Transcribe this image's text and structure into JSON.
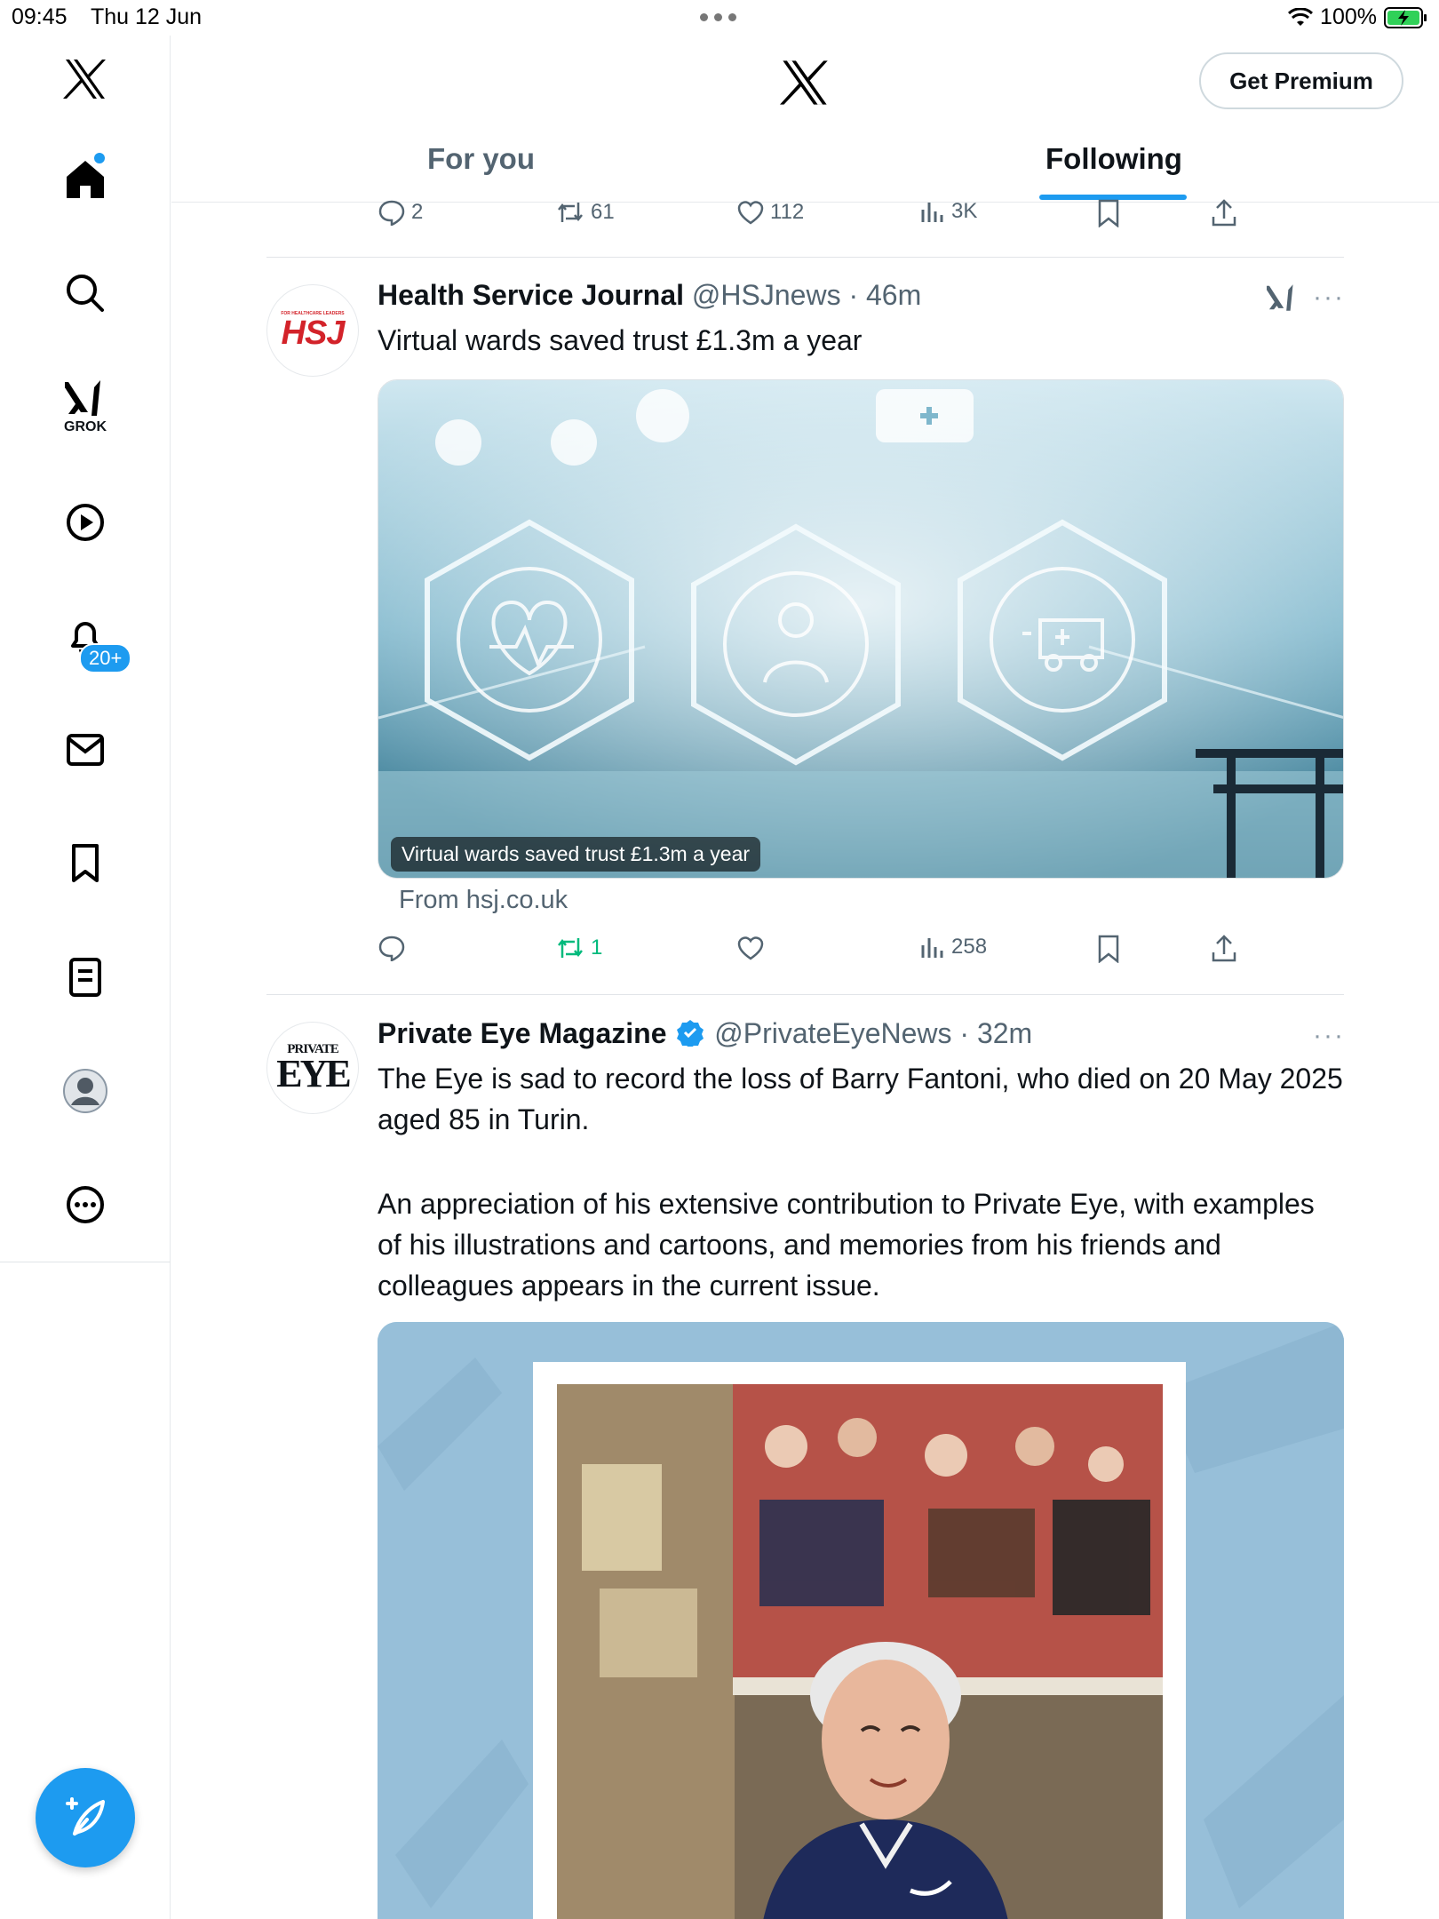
{
  "status": {
    "time": "09:45",
    "date": "Thu 12 Jun",
    "battery": "100%"
  },
  "sidebar": {
    "grok_label": "GROK",
    "notifications_badge": "20+"
  },
  "header": {
    "premium_label": "Get Premium",
    "tabs": [
      {
        "label": "For you",
        "active": false
      },
      {
        "label": "Following",
        "active": true
      }
    ]
  },
  "feed": {
    "prev_tweet_actions": {
      "replies": "2",
      "reposts": "61",
      "likes": "112",
      "views": "3K"
    },
    "tweets": [
      {
        "name": "Health Service Journal",
        "handle": "@HSJnews",
        "time": "46m",
        "avatar_text": "HSJ",
        "avatar_small_text": "FOR HEALTHCARE LEADERS",
        "text": "Virtual wards saved trust £1.3m a year",
        "media_caption": "Virtual wards saved trust £1.3m a year",
        "link_source": "From hsj.co.uk",
        "reposts": "1",
        "views": "258"
      },
      {
        "name": "Private Eye Magazine",
        "handle": "@PrivateEyeNews",
        "time": "32m",
        "verified": true,
        "avatar_top": "PRIVATE",
        "avatar_bottom": "EYE",
        "text_p1": "The Eye is sad to record the loss of Barry Fantoni, who died on 20 May 2025 aged 85 in Turin.",
        "text_p2": "An appreciation of his extensive contribution to Private Eye, with examples of his illustrations and cartoons, and memories from his friends and colleagues appears in the current issue."
      }
    ]
  },
  "colors": {
    "accent": "#1d9bf0",
    "muted": "#536471",
    "repost_green": "#00ba7c"
  }
}
